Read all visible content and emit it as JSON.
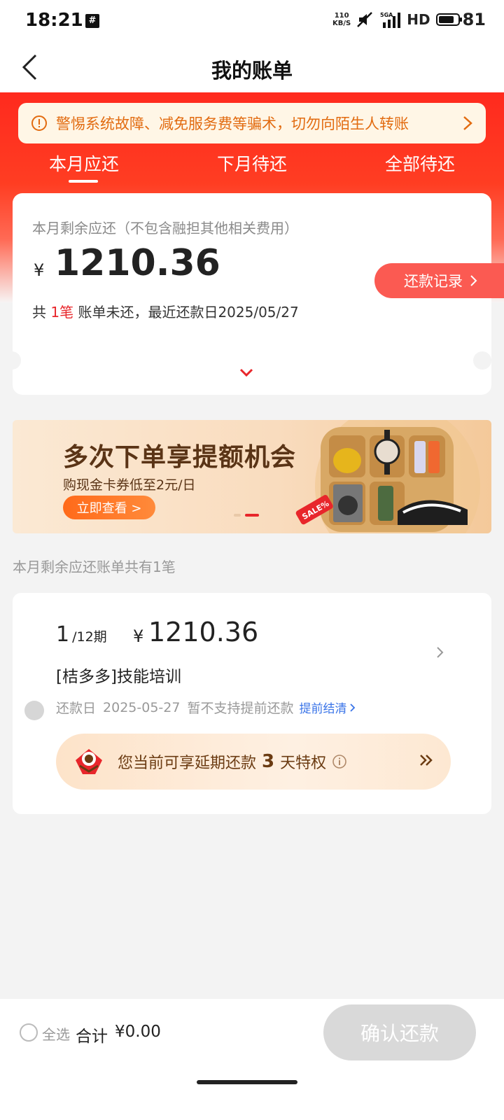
{
  "status_bar": {
    "time": "18:21",
    "hash_badge": "#",
    "net_speed_top": "110",
    "net_speed_bottom": "KB/S",
    "network_label": "5GA",
    "hd_label": "HD",
    "battery_level": "81",
    "battery_fraction": 0.81,
    "icons": [
      "mute-icon",
      "signal-icon",
      "battery-icon"
    ]
  },
  "nav": {
    "title": "我的账单",
    "back_icon": "chevron-left-icon"
  },
  "warning": {
    "text": "警惕系统故障、减免服务费等骗术，切勿向陌生人转账",
    "icon": "alert-circle-icon",
    "arrow_icon": "chevron-right-icon",
    "color": "#e26b10"
  },
  "tabs": [
    {
      "label": "本月应还",
      "active": true
    },
    {
      "label": "下月待还",
      "active": false
    },
    {
      "label": "全部待还",
      "active": false
    }
  ],
  "summary": {
    "caption": "本月剩余应还（不包含融担其他相关费用）",
    "currency": "¥",
    "amount": "1210.36",
    "info_prefix": "共 ",
    "info_count": "1笔",
    "info_suffix": " 账单未还，最近还款日2025/05/27",
    "repay_record_label": "还款记录",
    "accent_color": "#e8262b"
  },
  "promo": {
    "title": "多次下单享提额机会",
    "subtitle": "购现金卡券低至2元/日",
    "cta": "立即查看 >",
    "sale_tag": "SALE%"
  },
  "bill_count_note": "本月剩余应还账单共有1笔",
  "bill": {
    "installment_current": "1",
    "installment_total": "/12期",
    "currency": "¥",
    "amount": "1210.36",
    "name": "[桔多多]技能培训",
    "due_label": "还款日",
    "due_date": "2025-05-27",
    "early_note": "暂不支持提前还款",
    "early_settle_link": "提前结清",
    "extension_prefix": "您当前可享延期还款",
    "extension_days": "3",
    "extension_suffix": "天特权"
  },
  "bottom": {
    "select_all": "全选",
    "total_label": "合计",
    "total_amount": "¥0.00",
    "confirm_label": "确认还款"
  }
}
